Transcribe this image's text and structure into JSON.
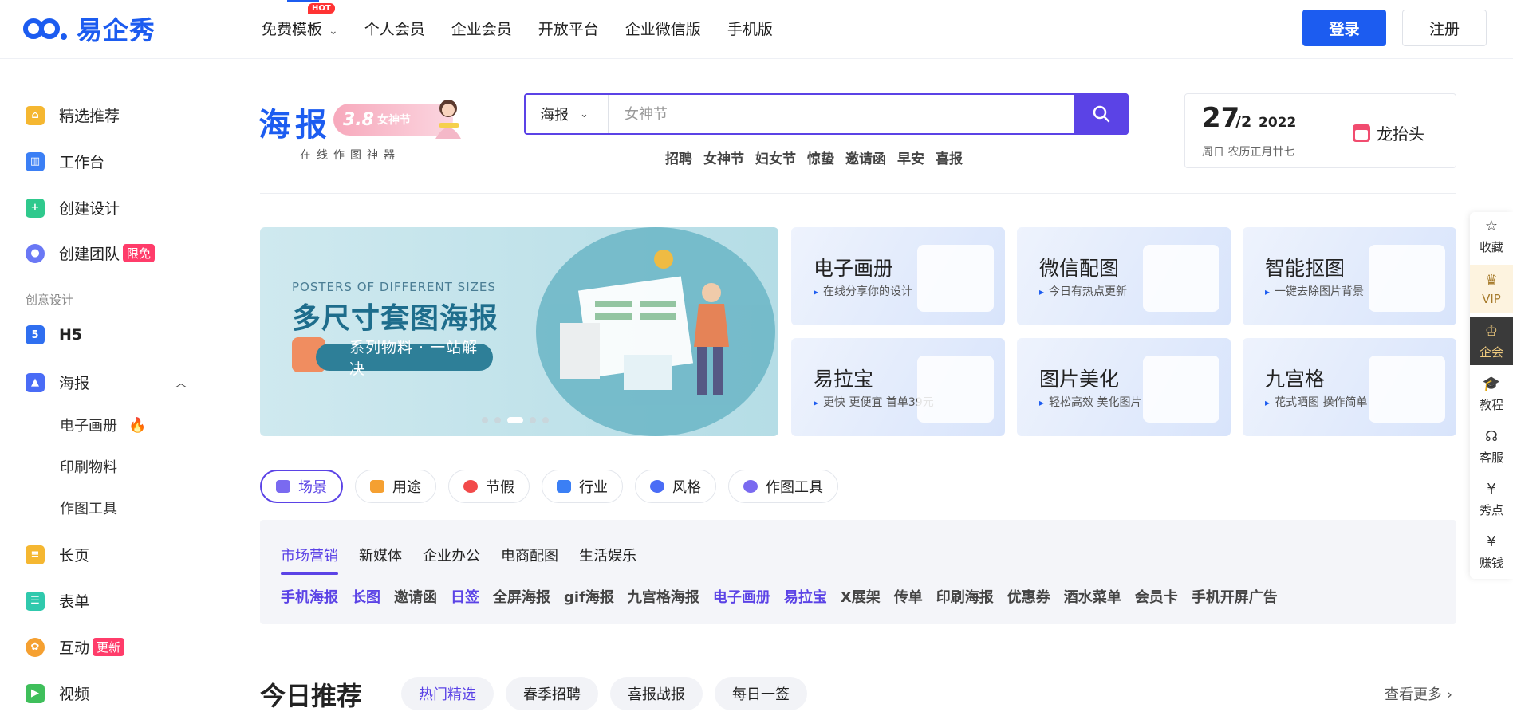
{
  "brand": {
    "name": "易企秀"
  },
  "nav": {
    "items": [
      {
        "label": "免费模板",
        "badge": "HOT",
        "dropdown": true
      },
      {
        "label": "个人会员"
      },
      {
        "label": "企业会员"
      },
      {
        "label": "开放平台"
      },
      {
        "label": "企业微信版"
      },
      {
        "label": "手机版"
      }
    ],
    "login": "登录",
    "register": "注册"
  },
  "sidebar": {
    "items": [
      {
        "label": "精选推荐",
        "color": "#f5b731"
      },
      {
        "label": "工作台",
        "color": "#3b7ff5"
      },
      {
        "label": "创建设计",
        "color": "#2fc98d"
      },
      {
        "label": "创建团队",
        "badge": "限免",
        "color": "#6a78f5"
      }
    ],
    "group_label": "创意设计",
    "design_items": [
      {
        "label": "H5",
        "color": "#2f6ff0"
      },
      {
        "label": "海报",
        "color": "#4a6cf6"
      }
    ],
    "poster_sub": [
      "电子画册",
      "印刷物料",
      "作图工具"
    ],
    "more_items": [
      {
        "label": "长页",
        "color": "#f5b731"
      },
      {
        "label": "表单",
        "color": "#30c9ad"
      },
      {
        "label": "互动",
        "badge": "更新",
        "color": "#f5a031"
      },
      {
        "label": "视频",
        "color": "#3fbf5b"
      }
    ]
  },
  "poster_header": {
    "title": "海报",
    "pill": "3.8",
    "pill_small": "女神节",
    "subtitle": "在线作图神器"
  },
  "search": {
    "type": "海报",
    "placeholder": "女神节",
    "hot_words": [
      "招聘",
      "女神节",
      "妇女节",
      "惊蛰",
      "邀请函",
      "早安",
      "喜报"
    ]
  },
  "date_card": {
    "day": "27",
    "month": "/2",
    "year": "2022",
    "lunar": "周日 农历正月廿七",
    "festival": "龙抬头"
  },
  "banner": {
    "en": "POSTERS OF DIFFERENT SIZES",
    "title": "多尺寸套图海报",
    "pill": "系列物料 · 一站解决",
    "slides": 5,
    "active_slide": 3
  },
  "cards": [
    {
      "title": "电子画册",
      "desc": "在线分享你的设计"
    },
    {
      "title": "微信配图",
      "desc": "今日有热点更新"
    },
    {
      "title": "智能抠图",
      "desc": "一键去除图片背景"
    },
    {
      "title": "易拉宝",
      "desc": "更快 更便宜 首单39元"
    },
    {
      "title": "图片美化",
      "desc": "轻松高效 美化图片"
    },
    {
      "title": "九宫格",
      "desc": "花式晒图 操作简单"
    }
  ],
  "category_tabs": [
    {
      "label": "场景",
      "color": "#7a6af0"
    },
    {
      "label": "用途",
      "color": "#f5a031"
    },
    {
      "label": "节假",
      "color": "#f24a4a"
    },
    {
      "label": "行业",
      "color": "#3b7ff5"
    },
    {
      "label": "风格",
      "color": "#4a6cf6"
    },
    {
      "label": "作图工具",
      "color": "#7a6af0"
    }
  ],
  "sub_tabs": [
    "市场营销",
    "新媒体",
    "企业办公",
    "电商配图",
    "生活娱乐"
  ],
  "tags": [
    {
      "label": "手机海报",
      "hl": true
    },
    {
      "label": "长图",
      "hl": true
    },
    {
      "label": "邀请函",
      "hl": false
    },
    {
      "label": "日签",
      "hl": true
    },
    {
      "label": "全屏海报",
      "hl": false
    },
    {
      "label": "gif海报",
      "hl": false
    },
    {
      "label": "九宫格海报",
      "hl": false
    },
    {
      "label": "电子画册",
      "hl": true
    },
    {
      "label": "易拉宝",
      "hl": true
    },
    {
      "label": "X展架",
      "hl": false
    },
    {
      "label": "传单",
      "hl": false
    },
    {
      "label": "印刷海报",
      "hl": false
    },
    {
      "label": "优惠券",
      "hl": false
    },
    {
      "label": "酒水菜单",
      "hl": false
    },
    {
      "label": "会员卡",
      "hl": false
    },
    {
      "label": "手机开屏广告",
      "hl": false
    }
  ],
  "recommend": {
    "title": "今日推荐",
    "tabs": [
      "热门精选",
      "春季招聘",
      "喜报战报",
      "每日一签"
    ],
    "more": "查看更多"
  },
  "right_bar": [
    {
      "label": "收藏",
      "icon": "star-icon",
      "glyph": "☆"
    },
    {
      "label": "VIP",
      "icon": "vip-icon",
      "glyph": "♛"
    },
    {
      "label": "企会",
      "icon": "crown-icon",
      "glyph": "♔"
    },
    {
      "label": "教程",
      "icon": "graduation-icon",
      "glyph": "🎓"
    },
    {
      "label": "客服",
      "icon": "headset-icon",
      "glyph": "☊"
    },
    {
      "label": "秀点",
      "icon": "coin-icon",
      "glyph": "¥"
    },
    {
      "label": "赚钱",
      "icon": "moneybag-icon",
      "glyph": "¥"
    }
  ]
}
